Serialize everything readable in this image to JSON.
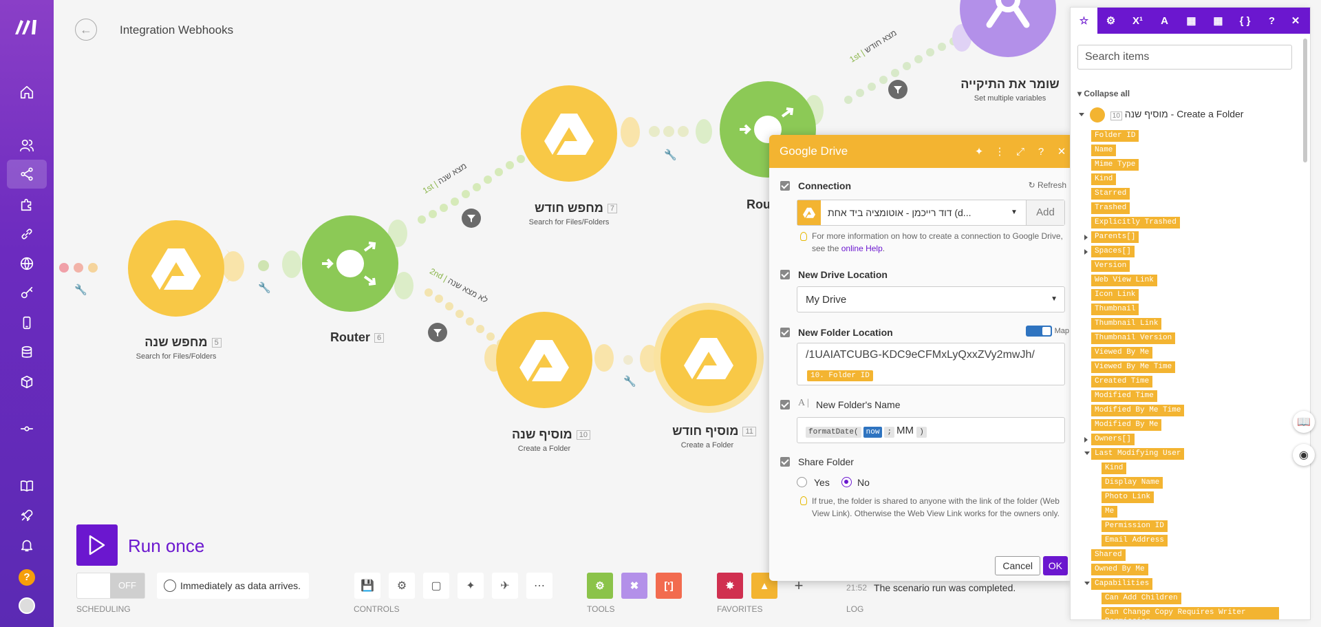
{
  "header": {
    "title": "Integration Webhooks"
  },
  "modules": [
    {
      "title": "מחפש שנה",
      "number": "5",
      "subtitle": "Search for Files/Folders",
      "color": "#f8c846"
    },
    {
      "title": "Router",
      "number": "6",
      "subtitle": "",
      "color": "#9bd16a"
    },
    {
      "title": "מחפש חודש",
      "number": "7",
      "subtitle": "Search for Files/Folders",
      "color": "#f8c846"
    },
    {
      "title": "Rou",
      "number": "",
      "subtitle": "",
      "color": "#9bd16a"
    },
    {
      "title": "שומר את התיקייה",
      "number": "",
      "subtitle": "Set multiple variables",
      "color": "#b390e9"
    },
    {
      "title": "מוסיף שנה",
      "number": "10",
      "subtitle": "Create a Folder",
      "color": "#f8c846"
    },
    {
      "title": "מוסיף חודש",
      "number": "11",
      "subtitle": "Create a Folder",
      "color": "#f8c846"
    }
  ],
  "routes": {
    "r1_order": "1st",
    "r1_label": "מצא שנה",
    "r2_order": "2nd",
    "r2_label": "לא מצא שנה",
    "r3_order": "1st",
    "r3_label": "מצא חודש"
  },
  "toolbar": {
    "run_label": "Run once",
    "scheduling_off": "OFF",
    "scheduling_text": "Immediately as data arrives.",
    "scheduling_section": "SCHEDULING",
    "controls_section": "CONTROLS",
    "tools_section": "TOOLS",
    "favorites_section": "FAVORITES",
    "log_section": "LOG",
    "tool_colors": [
      "#8bc34a",
      "#b390e9",
      "#f26b4f"
    ],
    "favorite_colors": [
      "#d03050",
      "#f3b431"
    ],
    "json_tool_glyph": "[']"
  },
  "log": {
    "time": "21:52",
    "message": "The scenario run was completed."
  },
  "dialog": {
    "title": "Google Drive",
    "connection_label": "Connection",
    "refresh_label": "Refresh",
    "connection_value": "דוד רייכמן - אוטומציה ביד אחת (d...",
    "add_label": "Add",
    "connection_hint": "For more information on how to create a connection to Google Drive, see the",
    "connection_hint_link": "online Help",
    "connection_hint_end": ".",
    "drive_location_label": "New Drive Location",
    "drive_location_value": "My Drive",
    "folder_location_label": "New Folder Location",
    "map_label": "Map",
    "folder_path": "/1UAIATCUBG-KDC9eCFMxLyQxxZVy2mwJh/",
    "folder_pill": "10. Folder ID",
    "folder_name_label": "New Folder's Name",
    "folder_name_fn": "formatDate(",
    "folder_name_now": "now",
    "folder_name_sep": ";",
    "folder_name_fmt": "MM",
    "folder_name_close": ")",
    "share_label": "Share Folder",
    "share_yes": "Yes",
    "share_no": "No",
    "share_selected": "No",
    "share_hint": "If true, the folder is shared to anyone with the link of the folder (Web View Link). Otherwise the Web View Link works for the owners only.",
    "cancel_label": "Cancel",
    "ok_label": "OK"
  },
  "mapping_panel": {
    "search_placeholder": "Search items",
    "collapse_all": "Collapse all",
    "root_title": "מוסיף שנה",
    "root_number": "10",
    "root_action": "- Create a Folder",
    "items": [
      "Folder ID",
      "Name",
      "Mime Type",
      "Kind",
      "Starred",
      "Trashed",
      "Explicitly Trashed",
      "Parents[]",
      "Spaces[]",
      "Version",
      "Web View Link",
      "Icon Link",
      "Thumbnail",
      "Thumbnail Link",
      "Thumbnail Version",
      "Viewed By Me",
      "Viewed By Me Time",
      "Created Time",
      "Modified Time",
      "Modified By Me Time",
      "Modified By Me",
      "Owners[]",
      "Last Modifying User"
    ],
    "last_modifying_user_children": [
      "Kind",
      "Display Name",
      "Photo Link",
      "Me",
      "Permission ID",
      "Email Address"
    ],
    "items_after": [
      "Shared",
      "Owned By Me",
      "Capabilities"
    ],
    "capabilities_children": [
      "Can Add Children",
      "Can Change Copy Requires Writer Permission"
    ]
  }
}
